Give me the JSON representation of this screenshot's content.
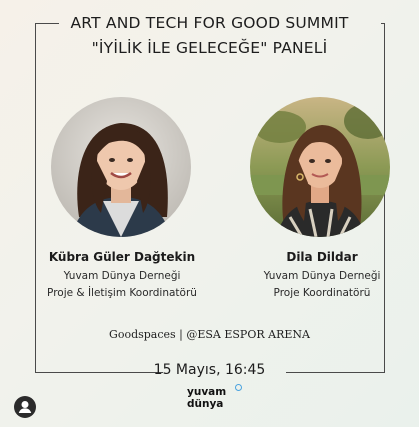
{
  "poster": {
    "title_line1": "ART AND TECH FOR GOOD SUMMIT",
    "title_line2": "\"İYİLİK İLE GELECEĞE\" PANELİ",
    "speaker1": {
      "name": "Kübra Güler Dağtekin",
      "organization": "Yuvam Dünya Derneği",
      "role": "Proje & İletişim Koordinatörü"
    },
    "speaker2": {
      "name": "Dila Dildar",
      "organization": "Yuvam Dünya Derneği",
      "role": "Proje Koordinatörü"
    },
    "venue": "Goodspaces | @ESA ESPOR ARENA",
    "date_time": "15 Mayıs, 16:45",
    "logo_line1": "yuvam",
    "logo_line2": "dünya"
  },
  "icons": {
    "account": "account-icon"
  },
  "colors": {
    "frame": "#4a4a4a",
    "logo_accent": "#4aa3df"
  }
}
